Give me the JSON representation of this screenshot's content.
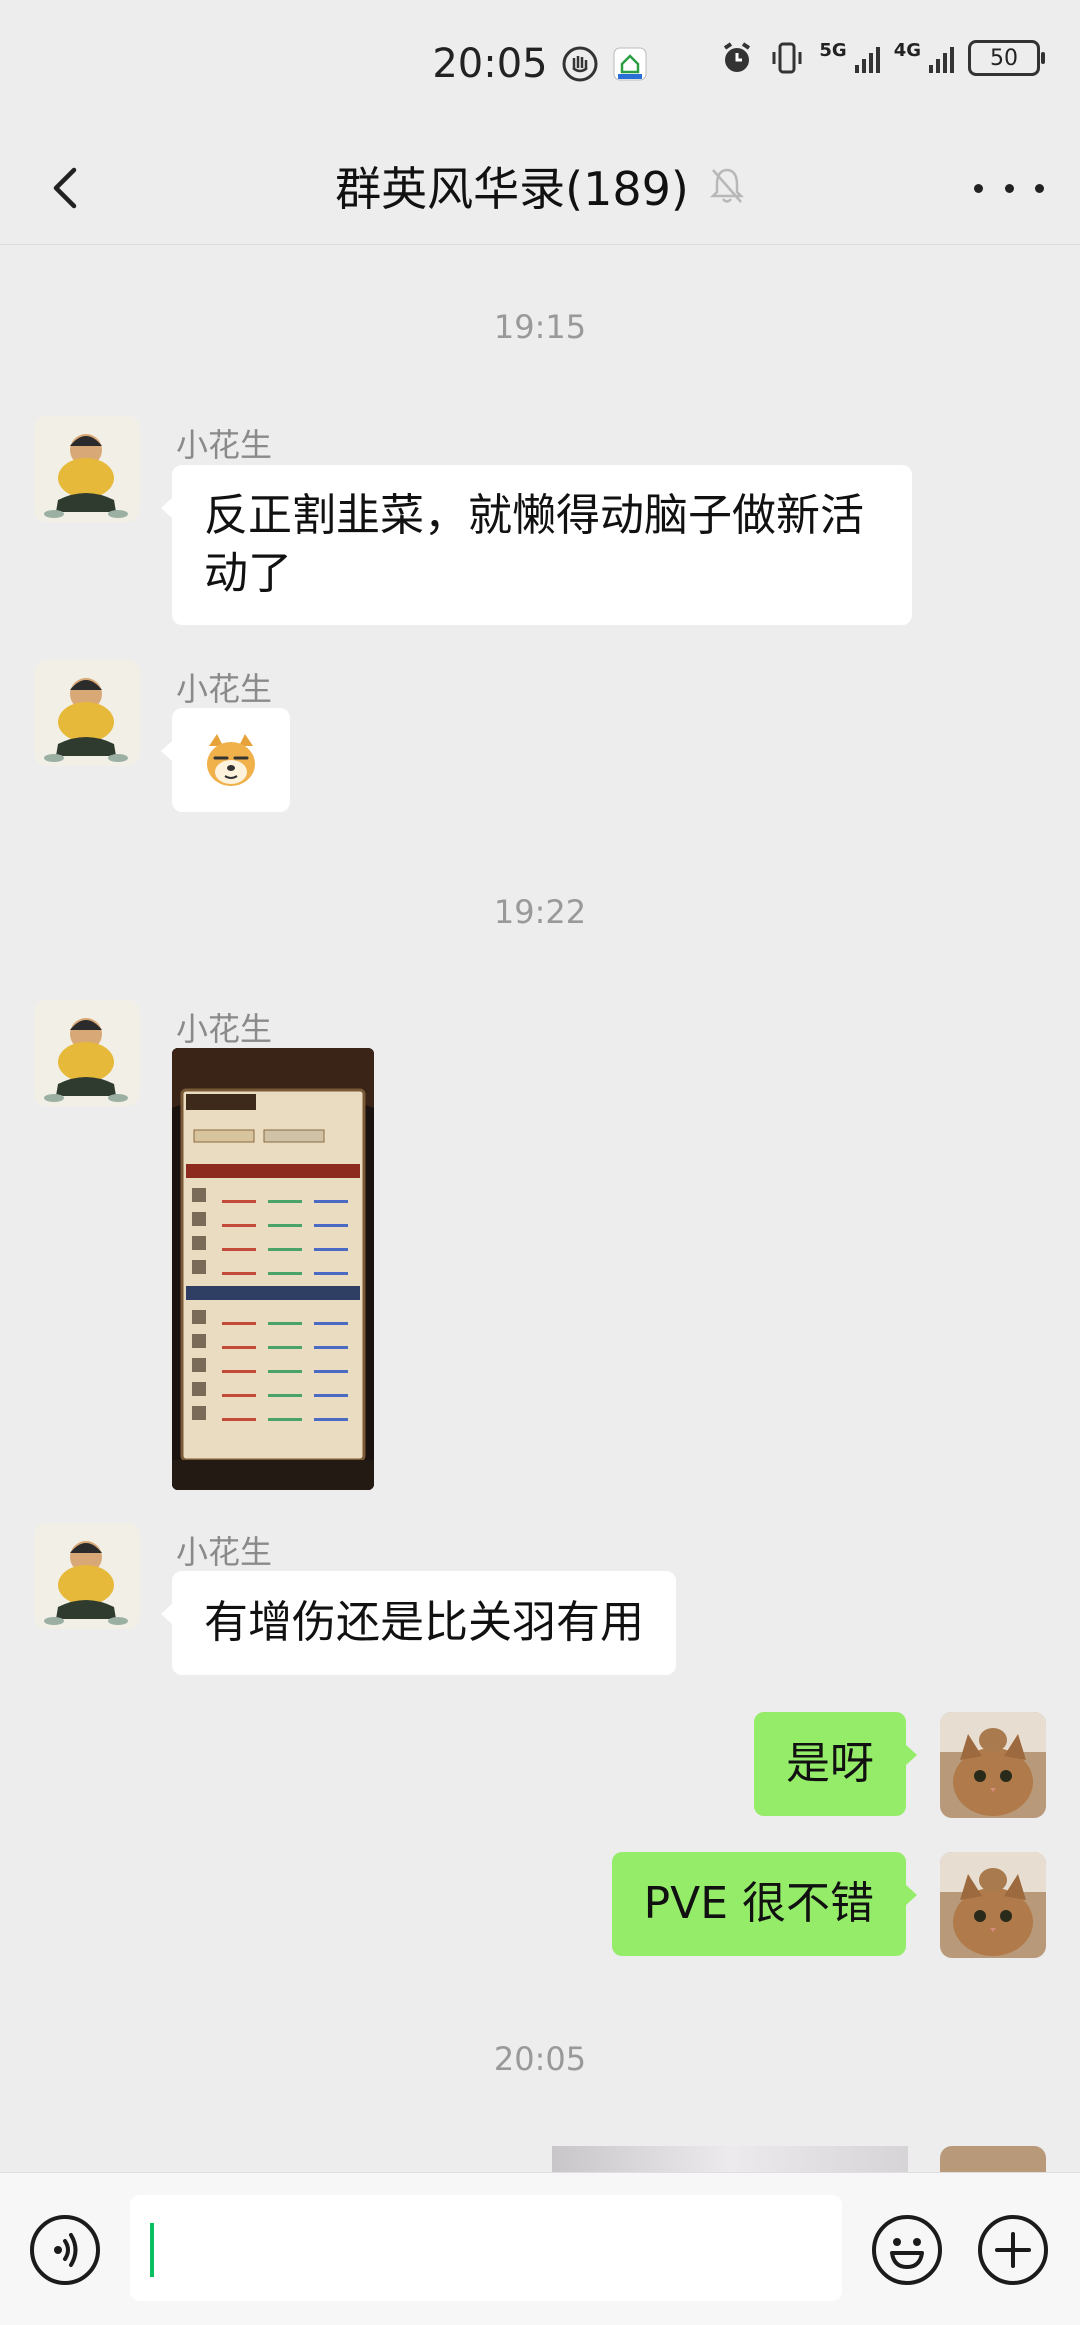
{
  "status_bar": {
    "time": "20:05",
    "battery": "50",
    "net1": "5G",
    "net2": "4G"
  },
  "header": {
    "title": "群英风华录(189)"
  },
  "messages": {
    "time1": "19:15",
    "m1_sender": "小花生",
    "m1_text": "反正割韭菜，就懒得动脑子做新活动了",
    "m2_sender": "小花生",
    "m2_emoji": "🐶",
    "time2": "19:22",
    "m3_sender": "小花生",
    "m4_sender": "小花生",
    "m4_text": "有增伤还是比关羽有用",
    "m5_text": "是呀",
    "m6_text": "PVE 很不错",
    "time3": "20:05"
  },
  "input": {
    "value": ""
  },
  "colors": {
    "background": "#ededed",
    "my_bubble": "#95ec69",
    "other_bubble": "#ffffff",
    "caret": "#07c160"
  }
}
